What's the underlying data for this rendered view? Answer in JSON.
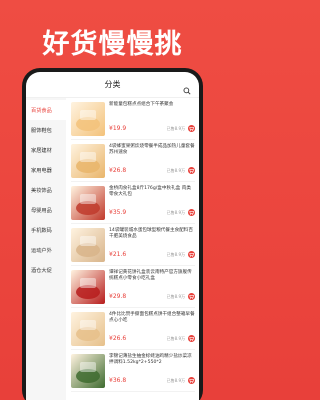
{
  "hero": {
    "title": "好货慢慢挑"
  },
  "topbar": {
    "title": "分类",
    "search_icon": "search-icon"
  },
  "sidebar": {
    "items": [
      {
        "label": "百货食品",
        "active": true
      },
      {
        "label": "服饰鞋包",
        "active": false
      },
      {
        "label": "家居建材",
        "active": false
      },
      {
        "label": "家用电器",
        "active": false
      },
      {
        "label": "美妆饰品",
        "active": false
      },
      {
        "label": "母婴用品",
        "active": false
      },
      {
        "label": "手机数码",
        "active": false
      },
      {
        "label": "运动户外",
        "active": false
      },
      {
        "label": "酒仓大促",
        "active": false
      }
    ]
  },
  "products": [
    {
      "name": "新能童包糕点点组合下午茶聚会",
      "price": "¥19.9",
      "sold": "已售8.9万",
      "color": "#f3c27a"
    },
    {
      "name": "4袋蜂蜜果粥炊烧零餐半成品加热儿童套餐苏州速食",
      "price": "¥26.8",
      "sold": "已售8.9万",
      "color": "#e9b56a"
    },
    {
      "name": "金桥肉食礼盒8斤176g/盒中秋礼盒 肉类零食大礼包",
      "price": "¥35.9",
      "sold": "已售8.9万",
      "color": "#c0392b"
    },
    {
      "name": "14袋罐装城水蛋包球型粮代餐主食配料百千肥美烧食品",
      "price": "¥21.6",
      "sold": "已售8.9万",
      "color": "#d8b48a"
    },
    {
      "name": "谭祥记黄花饼礼盒装云南特产官方旗舰传统糕点小零食小吃礼盒",
      "price": "¥29.8",
      "sold": "已售8.9万",
      "color": "#b71c1c"
    },
    {
      "name": "4件比比赞手撕面包糕点饼干组合整箱早餐点心小吃",
      "price": "¥26.6",
      "sold": "已售8.9万",
      "color": "#e6c08a"
    },
    {
      "name": "李锦记薄盐生抽金标蚝油鸡精少盐炒菜凉拌调料1.52kg*2+550*2",
      "price": "¥36.8",
      "sold": "已售8.9万",
      "color": "#3e6b2f"
    }
  ],
  "colors": {
    "accent": "#e8403a",
    "background": "#ef4d43"
  }
}
